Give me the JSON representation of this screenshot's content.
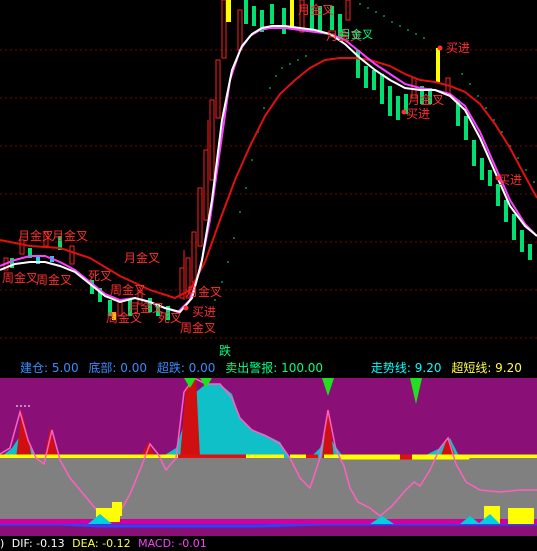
{
  "price_panel": {
    "annotations": {
      "golden_cross_month": "月金叉",
      "golden_cross_week": "周金叉",
      "buy": "买进",
      "drop": "跌",
      "death_cross": "死叉"
    },
    "colors": {
      "up_candle": "#ff2020",
      "down_candle": "#00e070",
      "yellow_candle": "#ffff00",
      "ma_white": "#ffffff",
      "ma_magenta": "#ff40ff",
      "ma_red": "#e01010",
      "dots_green": "#00c060",
      "grid": "#800000"
    }
  },
  "info_bar": {
    "position_label": "建仓: 5.00",
    "bottom_label": "底部: 0.00",
    "oversold_label": "超跌: 0.00",
    "sell_alert_label": "卖出警报: 100.00",
    "trend_label": "走势线: 9.20",
    "ultrashort_label": "超短线: 9.20"
  },
  "macd_bar": {
    "prefix": ")",
    "dif": "DIF: -0.13",
    "dea": "DEA: -0.12",
    "macd": "MACD: -0.01"
  }
}
